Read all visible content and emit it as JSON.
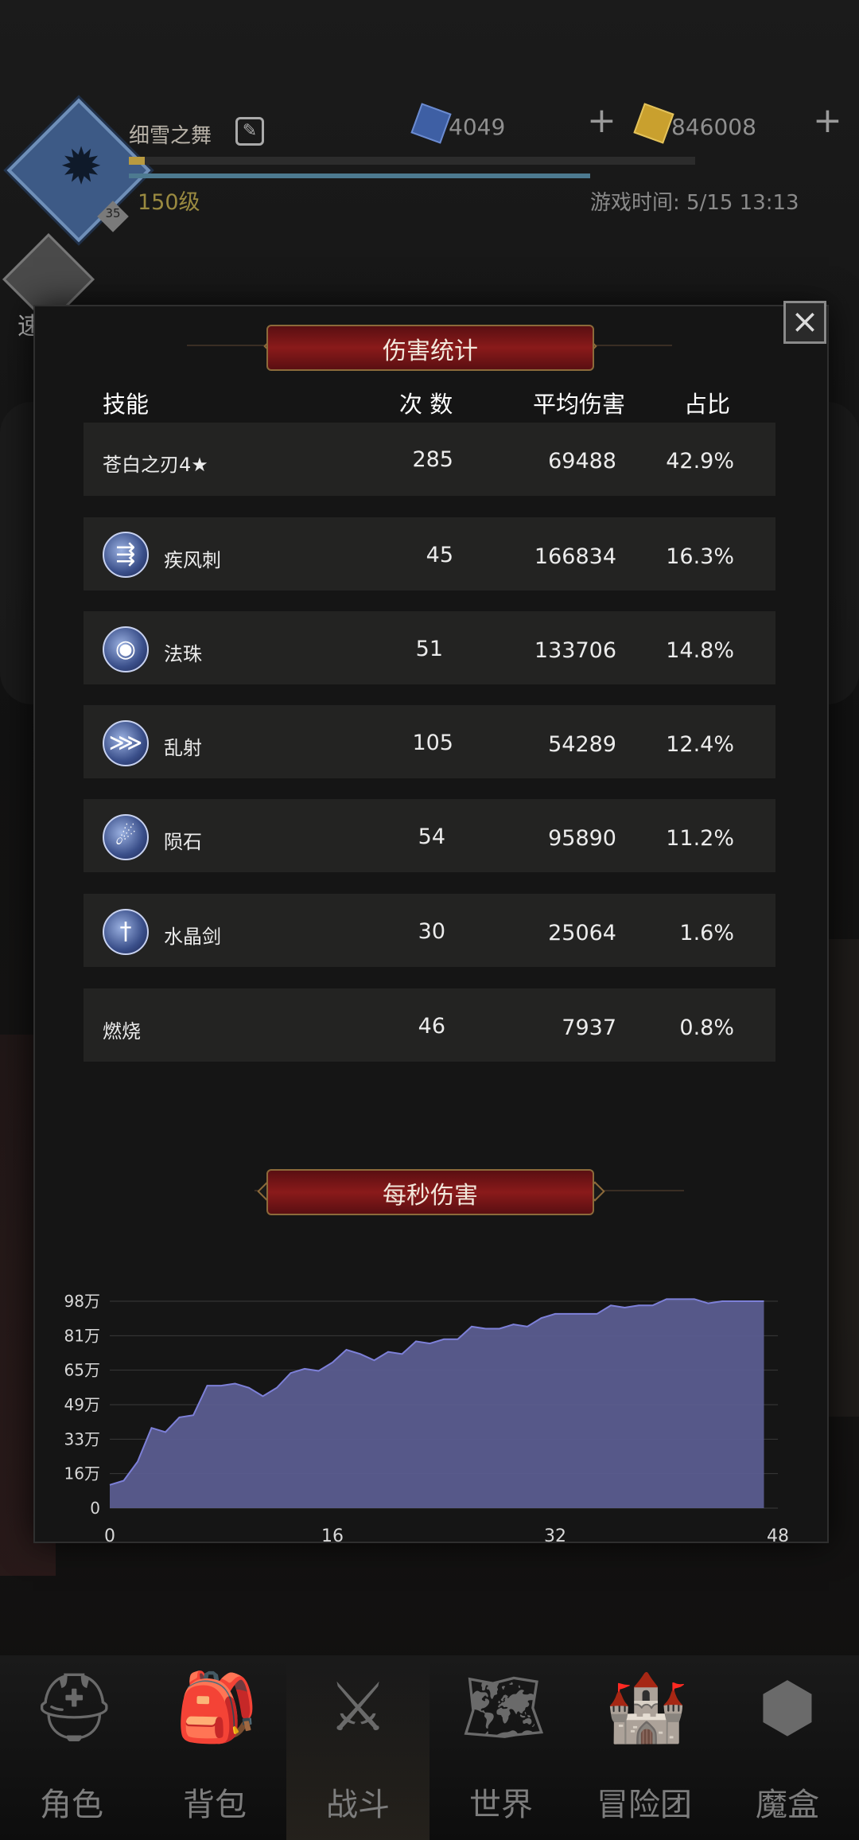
{
  "header": {
    "player_name": "细雪之舞",
    "avatar_level_badge": "35",
    "level": "150级",
    "gems": "4049",
    "gold": "846008",
    "game_time": "游戏时间: 5/15 13:13",
    "quick_battle": "速战"
  },
  "dialog": {
    "title": "伤害统计",
    "columns": {
      "skill": "技能",
      "count": "次 数",
      "avg": "平均伤害",
      "ratio": "占比"
    },
    "rows": [
      {
        "name": "苍白之刃4★",
        "count": "285",
        "avg": "69488",
        "ratio": "42.9%",
        "icon": ""
      },
      {
        "name": "疾风刺",
        "count": "45",
        "avg": "166834",
        "ratio": "16.3%",
        "icon": "wind-stab-icon"
      },
      {
        "name": "法珠",
        "count": "51",
        "avg": "133706",
        "ratio": "14.8%",
        "icon": "magic-orb-icon"
      },
      {
        "name": "乱射",
        "count": "105",
        "avg": "54289",
        "ratio": "12.4%",
        "icon": "barrage-icon"
      },
      {
        "name": "陨石",
        "count": "54",
        "avg": "95890",
        "ratio": "11.2%",
        "icon": "meteor-icon"
      },
      {
        "name": "水晶剑",
        "count": "30",
        "avg": "25064",
        "ratio": "1.6%",
        "icon": "crystal-sword-icon"
      },
      {
        "name": "燃烧",
        "count": "46",
        "avg": "7937",
        "ratio": "0.8%",
        "icon": ""
      }
    ],
    "dps_title": "每秒伤害"
  },
  "chart_data": {
    "type": "area",
    "title": "每秒伤害",
    "xlabel": "",
    "ylabel": "",
    "x_ticks": [
      "0",
      "16",
      "32",
      "48"
    ],
    "y_ticks": [
      "0",
      "16万",
      "33万",
      "49万",
      "65万",
      "81万",
      "98万"
    ],
    "xlim": [
      0,
      48
    ],
    "ylim": [
      0,
      98
    ],
    "color": "#5d5f96",
    "x": [
      0,
      1,
      2,
      3,
      4,
      5,
      6,
      7,
      8,
      9,
      10,
      11,
      12,
      13,
      14,
      15,
      16,
      17,
      18,
      19,
      20,
      21,
      22,
      23,
      24,
      25,
      26,
      27,
      28,
      29,
      30,
      31,
      32,
      33,
      34,
      35,
      36,
      37,
      38,
      39,
      40,
      41,
      42,
      43,
      44,
      45,
      46,
      47
    ],
    "values": [
      11,
      13,
      22,
      38,
      36,
      43,
      44,
      58,
      58,
      59,
      57,
      53,
      57,
      64,
      66,
      65,
      69,
      75,
      73,
      70,
      74,
      73,
      79,
      78,
      80,
      80,
      86,
      85,
      85,
      87,
      86,
      90,
      92,
      92,
      92,
      92,
      96,
      95,
      96,
      96,
      99,
      99,
      99,
      97,
      98,
      98,
      98,
      98
    ]
  },
  "nav": [
    {
      "label": "角色",
      "icon": "helmet-icon"
    },
    {
      "label": "背包",
      "icon": "backpack-icon"
    },
    {
      "label": "战斗",
      "icon": "sword-shield-icon"
    },
    {
      "label": "世界",
      "icon": "map-scroll-icon"
    },
    {
      "label": "冒险团",
      "icon": "castle-icon"
    },
    {
      "label": "魔盒",
      "icon": "magic-box-icon"
    }
  ]
}
